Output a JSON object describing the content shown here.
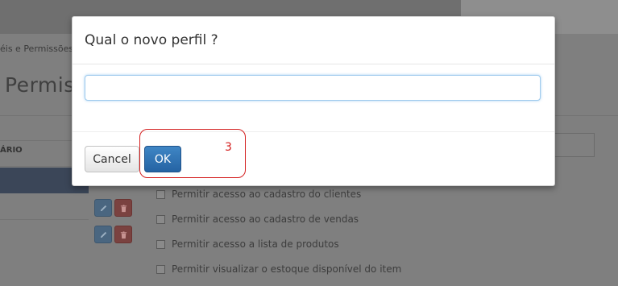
{
  "background": {
    "breadcrumb": "éis e Permissões",
    "page_title": "Permiss",
    "column_header": "ÁRIO",
    "permissions": [
      "Permitir acesso ao cadastro do clientes",
      "Permitir acesso ao cadastro de vendas",
      "Permitir acesso a lista de produtos",
      "Permitir visualizar o estoque disponível do item"
    ]
  },
  "dialog": {
    "title": "Qual o novo perfil ?",
    "input_value": "",
    "input_placeholder": "",
    "cancel_label": "Cancel",
    "ok_label": "OK"
  },
  "annotation": {
    "number": "3",
    "color": "#d42020"
  },
  "icons": {
    "edit": "pencil-icon",
    "delete": "trash-icon"
  }
}
